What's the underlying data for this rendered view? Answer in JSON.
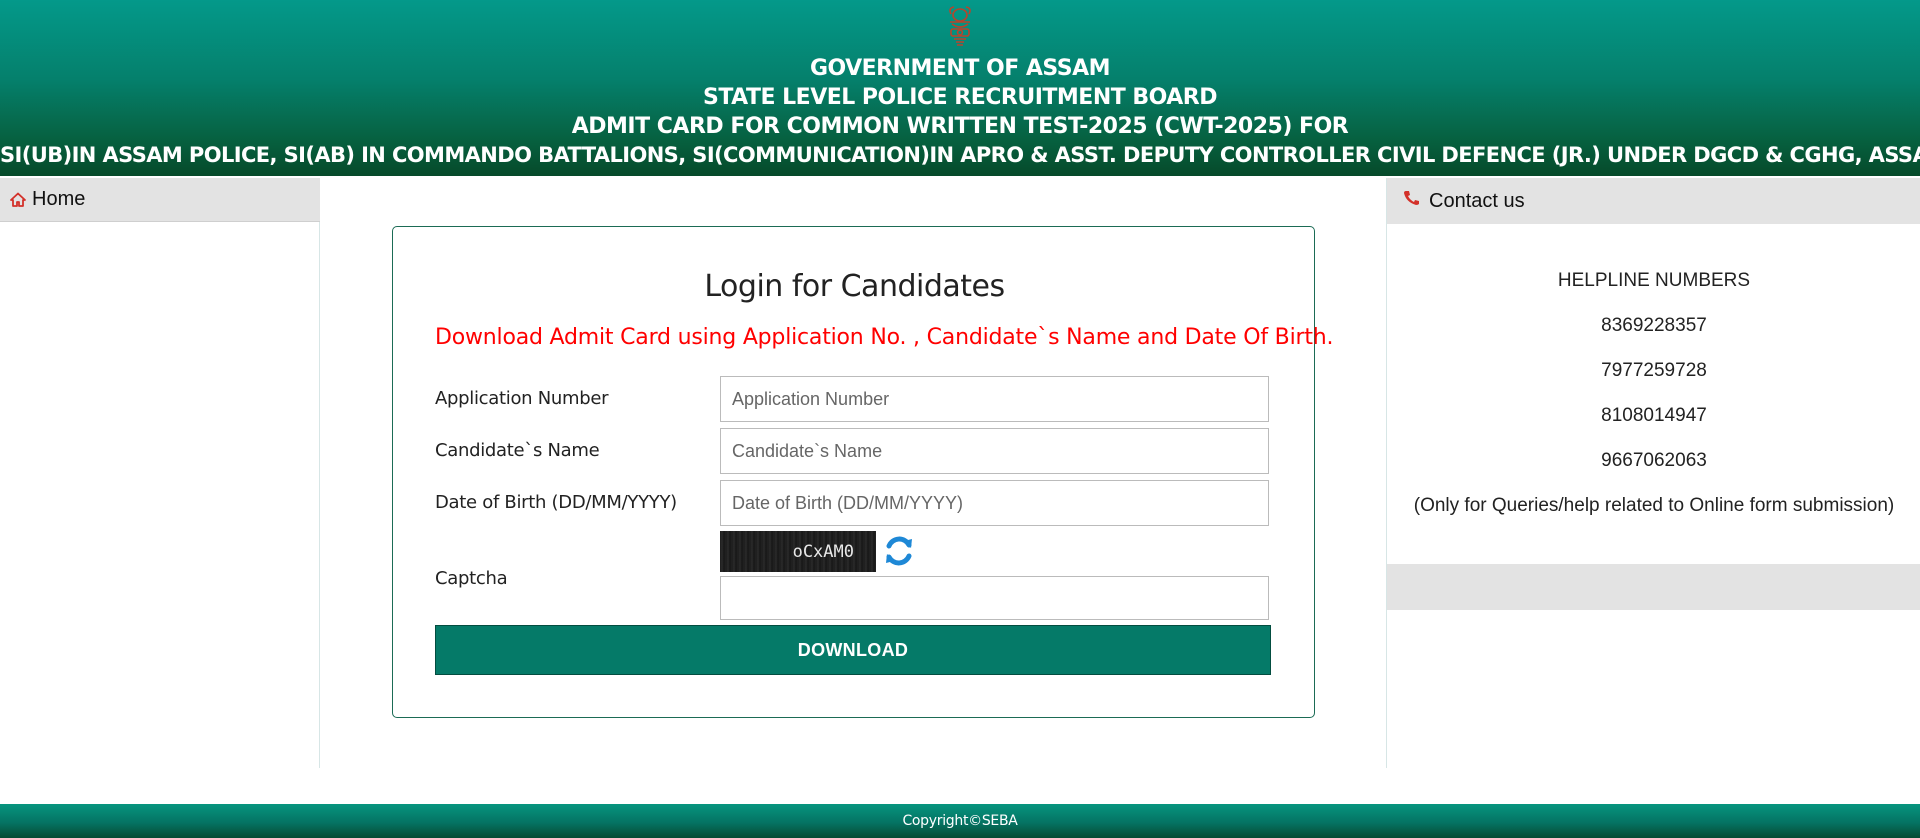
{
  "header": {
    "emblem": "national-emblem",
    "line1": "GOVERNMENT OF ASSAM",
    "line2": "STATE LEVEL POLICE RECRUITMENT BOARD",
    "line3": "ADMIT CARD FOR COMMON WRITTEN TEST-2025 (CWT-2025) FOR",
    "line4": "SI(UB)IN ASSAM POLICE, SI(AB) IN COMMANDO BATTALIONS, SI(COMMUNICATION)IN APRO & ASST. DEPUTY CONTROLLER CIVIL DEFENCE (JR.) UNDER DGCD & CGHG, ASSAM"
  },
  "sidebar_left": {
    "home_label": "Home",
    "home_icon": "home-icon"
  },
  "sidebar_right": {
    "contact_label": "Contact us",
    "contact_icon": "phone-icon",
    "helpline_title": "HELPLINE NUMBERS",
    "numbers": [
      "8369228357",
      "7977259728",
      "8108014947",
      "9667062063"
    ],
    "note": "(Only for Queries/help related to Online form submission)"
  },
  "login": {
    "title": "Login for Candidates",
    "subtitle": "Download Admit Card using Application No. , Candidate`s Name and Date Of Birth.",
    "fields": {
      "application_number": {
        "label": "Application Number",
        "placeholder": "Application Number",
        "value": ""
      },
      "candidate_name": {
        "label": "Candidate`s Name",
        "placeholder": "Candidate`s Name",
        "value": ""
      },
      "dob": {
        "label": "Date of Birth (DD/MM/YYYY)",
        "placeholder": "Date of Birth (DD/MM/YYYY)",
        "value": ""
      },
      "captcha": {
        "label": "Captcha",
        "image_text": "oCxAM0",
        "value": ""
      }
    },
    "download_label": "DOWNLOAD"
  },
  "footer": {
    "copyright": "Copyright©SEBA"
  },
  "colors": {
    "header_green": "#05806c",
    "button_green": "#057a68",
    "alert_red": "#ff0000",
    "sidebar_grey": "#e3e3e3"
  }
}
